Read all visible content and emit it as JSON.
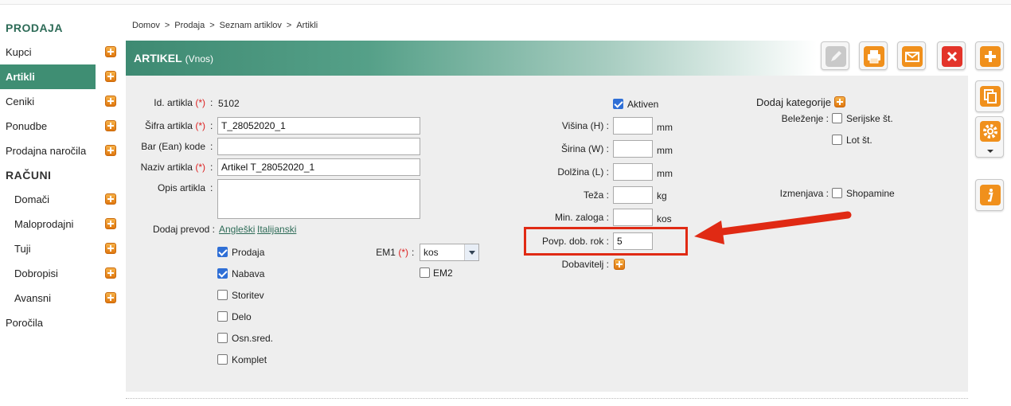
{
  "sidebar": {
    "section1": "PRODAJA",
    "items1": [
      {
        "label": "Kupci"
      },
      {
        "label": "Artikli"
      },
      {
        "label": "Ceniki"
      },
      {
        "label": "Ponudbe"
      },
      {
        "label": "Prodajna naročila"
      }
    ],
    "section2": "RAČUNI",
    "items2": [
      {
        "label": "Domači"
      },
      {
        "label": "Maloprodajni"
      },
      {
        "label": "Tuji"
      },
      {
        "label": "Dobropisi"
      },
      {
        "label": "Avansni"
      }
    ],
    "reports": "Poročila"
  },
  "breadcrumb": [
    "Domov",
    "Prodaja",
    "Seznam artiklov",
    "Artikli"
  ],
  "breadcrumb_sep": ">",
  "header": {
    "title": "ARTIKEL",
    "subtitle": "(Vnos)"
  },
  "form": {
    "req": "(*)",
    "colon": ":",
    "id_label": "Id. artikla",
    "id_value": "5102",
    "sifra_label": "Šifra artikla",
    "sifra_value": "T_28052020_1",
    "ean_label": "Bar (Ean) kode",
    "ean_value": "",
    "naziv_label": "Naziv artikla",
    "naziv_value": "Artikel T_28052020_1",
    "opis_label": "Opis artikla",
    "opis_value": "",
    "prevod_label": "Dodaj prevod :",
    "prevod_links": [
      "Angleški",
      "Italijanski"
    ],
    "types": [
      {
        "label": "Prodaja",
        "checked": true
      },
      {
        "label": "Nabava",
        "checked": true
      },
      {
        "label": "Storitev",
        "checked": false
      },
      {
        "label": "Delo",
        "checked": false
      },
      {
        "label": "Osn.sred.",
        "checked": false
      },
      {
        "label": "Komplet",
        "checked": false
      }
    ],
    "em1_label": "EM1",
    "em1_value": "kos",
    "em2_label": "EM2",
    "aktiven_label": "Aktiven",
    "visina_label": "Višina (H) :",
    "visina_unit": "mm",
    "sirina_label": "Širina (W) :",
    "sirina_unit": "mm",
    "dolzina_label": "Dolžina (L) :",
    "dolzina_unit": "mm",
    "teza_label": "Teža :",
    "teza_unit": "kg",
    "zaloga_label": "Min. zaloga :",
    "zaloga_unit": "kos",
    "povp_label": "Povp. dob. rok :",
    "povp_value": "5",
    "dobavitelj_label": "Dobavitelj :",
    "kategorije_label": "Dodaj kategorije",
    "belezenje_label": "Beleženje :",
    "serijske_label": "Serijske št.",
    "lot_label": "Lot št.",
    "izmenjava_label": "Izmenjava :",
    "shopamine_label": "Shopamine"
  },
  "colors": {
    "brand": "#3f8e73",
    "accent_orange": "#f0901c",
    "highlight_red": "#e02a14",
    "panel_bg": "#eeeeee"
  },
  "icons": [
    "plus-icon",
    "pencil-icon",
    "printer-icon",
    "mail-icon",
    "close-icon",
    "add-icon",
    "copy-icon",
    "gear-icon",
    "info-icon"
  ]
}
